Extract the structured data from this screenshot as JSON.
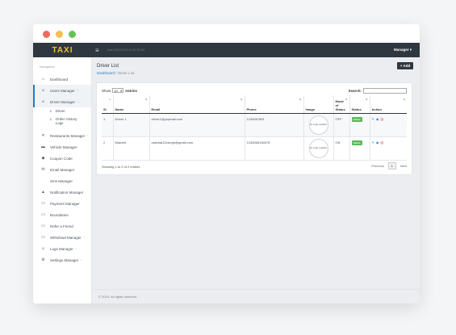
{
  "window": {
    "controls": {
      "close_color": "#ee6b5e",
      "minimize_color": "#f4bf4f",
      "maximize_color": "#61c554"
    }
  },
  "header": {
    "brand": "TAXI",
    "menu_icon": "hamburger-icon",
    "date_text": "Date 05/06/2019 10:44:25 AM",
    "user_menu": "Manager ▾"
  },
  "sidebar": {
    "heading": "Navigation",
    "items": [
      {
        "label": "Dashboard",
        "icon": "home-icon"
      },
      {
        "label": "Users Manager",
        "icon": "user-icon",
        "caret": "›"
      },
      {
        "label": "Driver Manager",
        "icon": "user-icon",
        "caret": "⌄"
      },
      {
        "label": "Restaurants Manager",
        "icon": "utensils-icon",
        "caret": "›"
      },
      {
        "label": "Vehicle Manager",
        "icon": "car-icon"
      },
      {
        "label": "Coupon Code",
        "icon": "tag-icon"
      },
      {
        "label": "Email Manager",
        "icon": "envelope-icon"
      },
      {
        "label": "Sms Manager",
        "icon": "comment-icon"
      },
      {
        "label": "Notification Manager",
        "icon": "bell-icon"
      },
      {
        "label": "Payment Manager",
        "icon": "card-icon"
      },
      {
        "label": "Boundaries",
        "icon": "card-icon"
      },
      {
        "label": "Refer a Friend",
        "icon": "card-icon"
      },
      {
        "label": "Withdrawl Manager",
        "icon": "card-icon",
        "caret": "›"
      },
      {
        "label": "Logs Manager",
        "icon": "user-icon",
        "caret": "›"
      },
      {
        "label": "Settings Manager",
        "icon": "gear-icon",
        "caret": "›"
      }
    ],
    "driver_sub": [
      {
        "label": "Driver",
        "icon": "driver-icon"
      },
      {
        "label": "Order History Logs",
        "icon": "driver-icon"
      }
    ]
  },
  "main": {
    "title": "Driver List",
    "breadcrumb": {
      "home": "Dashboard",
      "separator": "/",
      "current": "Driver List"
    },
    "add_button": "+ Add",
    "length": {
      "prefix": "Show",
      "value": "10",
      "suffix": "entries"
    },
    "search_label": "Search:",
    "columns": [
      "Sl",
      "Name",
      "Email",
      "Phone",
      "Image",
      "Mode of Status",
      "Status",
      "Action"
    ],
    "rows": [
      {
        "sl": "1",
        "name": "Driver 1",
        "email": "driver1@yopmail.com",
        "phone": "1234567891",
        "image": "No image available",
        "mode": "OFF",
        "status": "Active"
      },
      {
        "sl": "2",
        "name": "Manzek",
        "email": "vssbhat111singh@gmail.com",
        "phone": "1234568136578",
        "image": "No image available",
        "mode": "ON",
        "status": "Active"
      }
    ],
    "info": "Showing 1 to 2 of 2 entries",
    "pager": {
      "prev": "Previous",
      "current": "1",
      "next": "Next"
    }
  },
  "footer": {
    "text": "© 2019. All rights reserved."
  },
  "colors": {
    "topbar": "#2f3740",
    "brand": "#f2c12e",
    "accent": "#1f7bc4",
    "active_badge": "#5cb85c"
  }
}
